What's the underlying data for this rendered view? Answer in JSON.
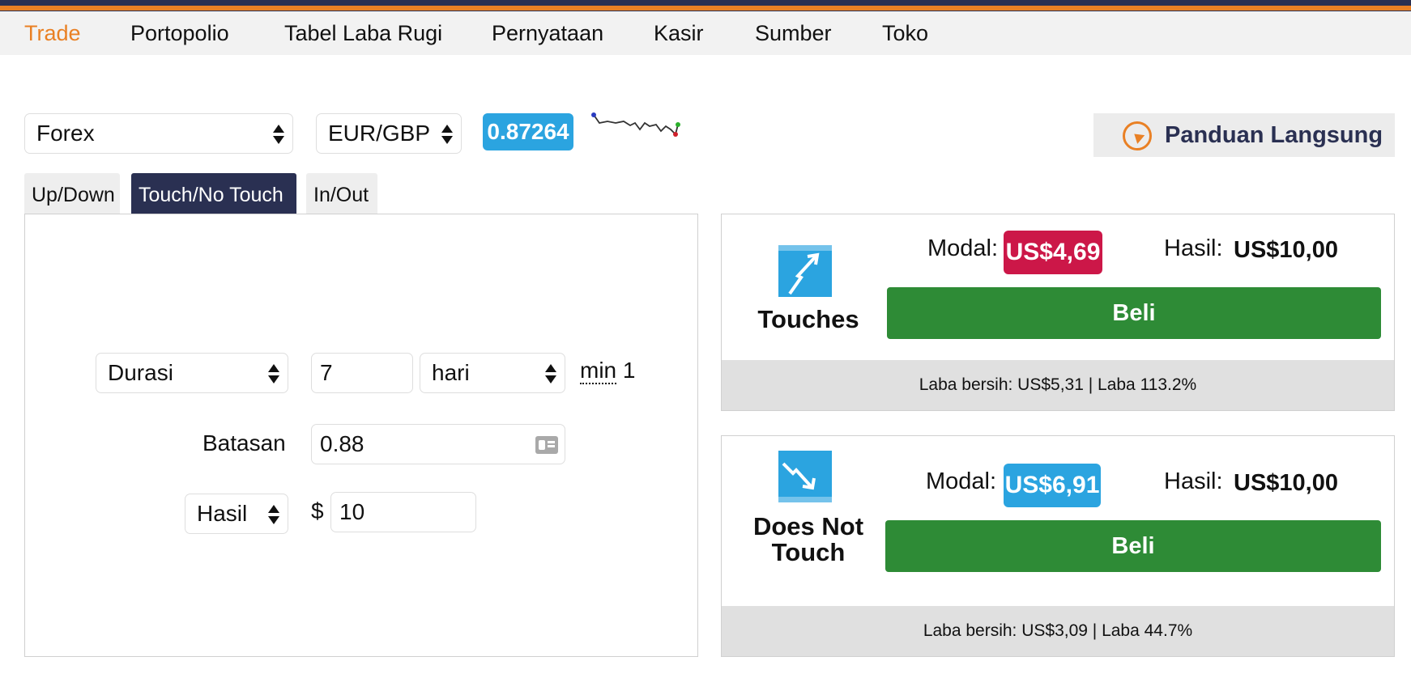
{
  "nav": {
    "items": [
      {
        "label": "Trade",
        "active": true
      },
      {
        "label": "Portopolio"
      },
      {
        "label": "Tabel Laba Rugi"
      },
      {
        "label": "Pernyataan"
      },
      {
        "label": "Kasir"
      },
      {
        "label": "Sumber"
      },
      {
        "label": "Toko"
      }
    ]
  },
  "market": {
    "selected": "Forex",
    "symbol": "EUR/GBP",
    "quote": "0.87264"
  },
  "guide": {
    "label": "Panduan Langsung",
    "icon": "compass-icon"
  },
  "tabs": [
    {
      "label": "Up/Down"
    },
    {
      "label": "Touch/No Touch",
      "active": true
    },
    {
      "label": "In/Out"
    }
  ],
  "form": {
    "duration_type": "Durasi",
    "duration_value": "7",
    "duration_unit": "hari",
    "min_label": "min",
    "min_value": "1",
    "barrier_label": "Batasan",
    "barrier_value": "0.88",
    "payout_type": "Hasil",
    "currency_symbol": "$",
    "amount": "10"
  },
  "offers": [
    {
      "name": "Touches",
      "modal_label": "Modal:",
      "price": "US$4,69",
      "price_color": "#cc1748",
      "hasil_label": "Hasil:",
      "hasil_value": "US$10,00",
      "buy_label": "Beli",
      "footer": "Laba bersih: US$5,31 | Laba 113.2%"
    },
    {
      "name": "Does Not Touch",
      "modal_label": "Modal:",
      "price": "US$6,91",
      "price_color": "#2ba4e0",
      "hasil_label": "Hasil:",
      "hasil_value": "US$10,00",
      "buy_label": "Beli",
      "footer": "Laba bersih: US$3,09 | Laba 44.7%"
    }
  ],
  "colors": {
    "accent": "#e98024",
    "navy": "#2a3052",
    "buy": "#2e8b36",
    "quote": "#2ba4e0"
  }
}
